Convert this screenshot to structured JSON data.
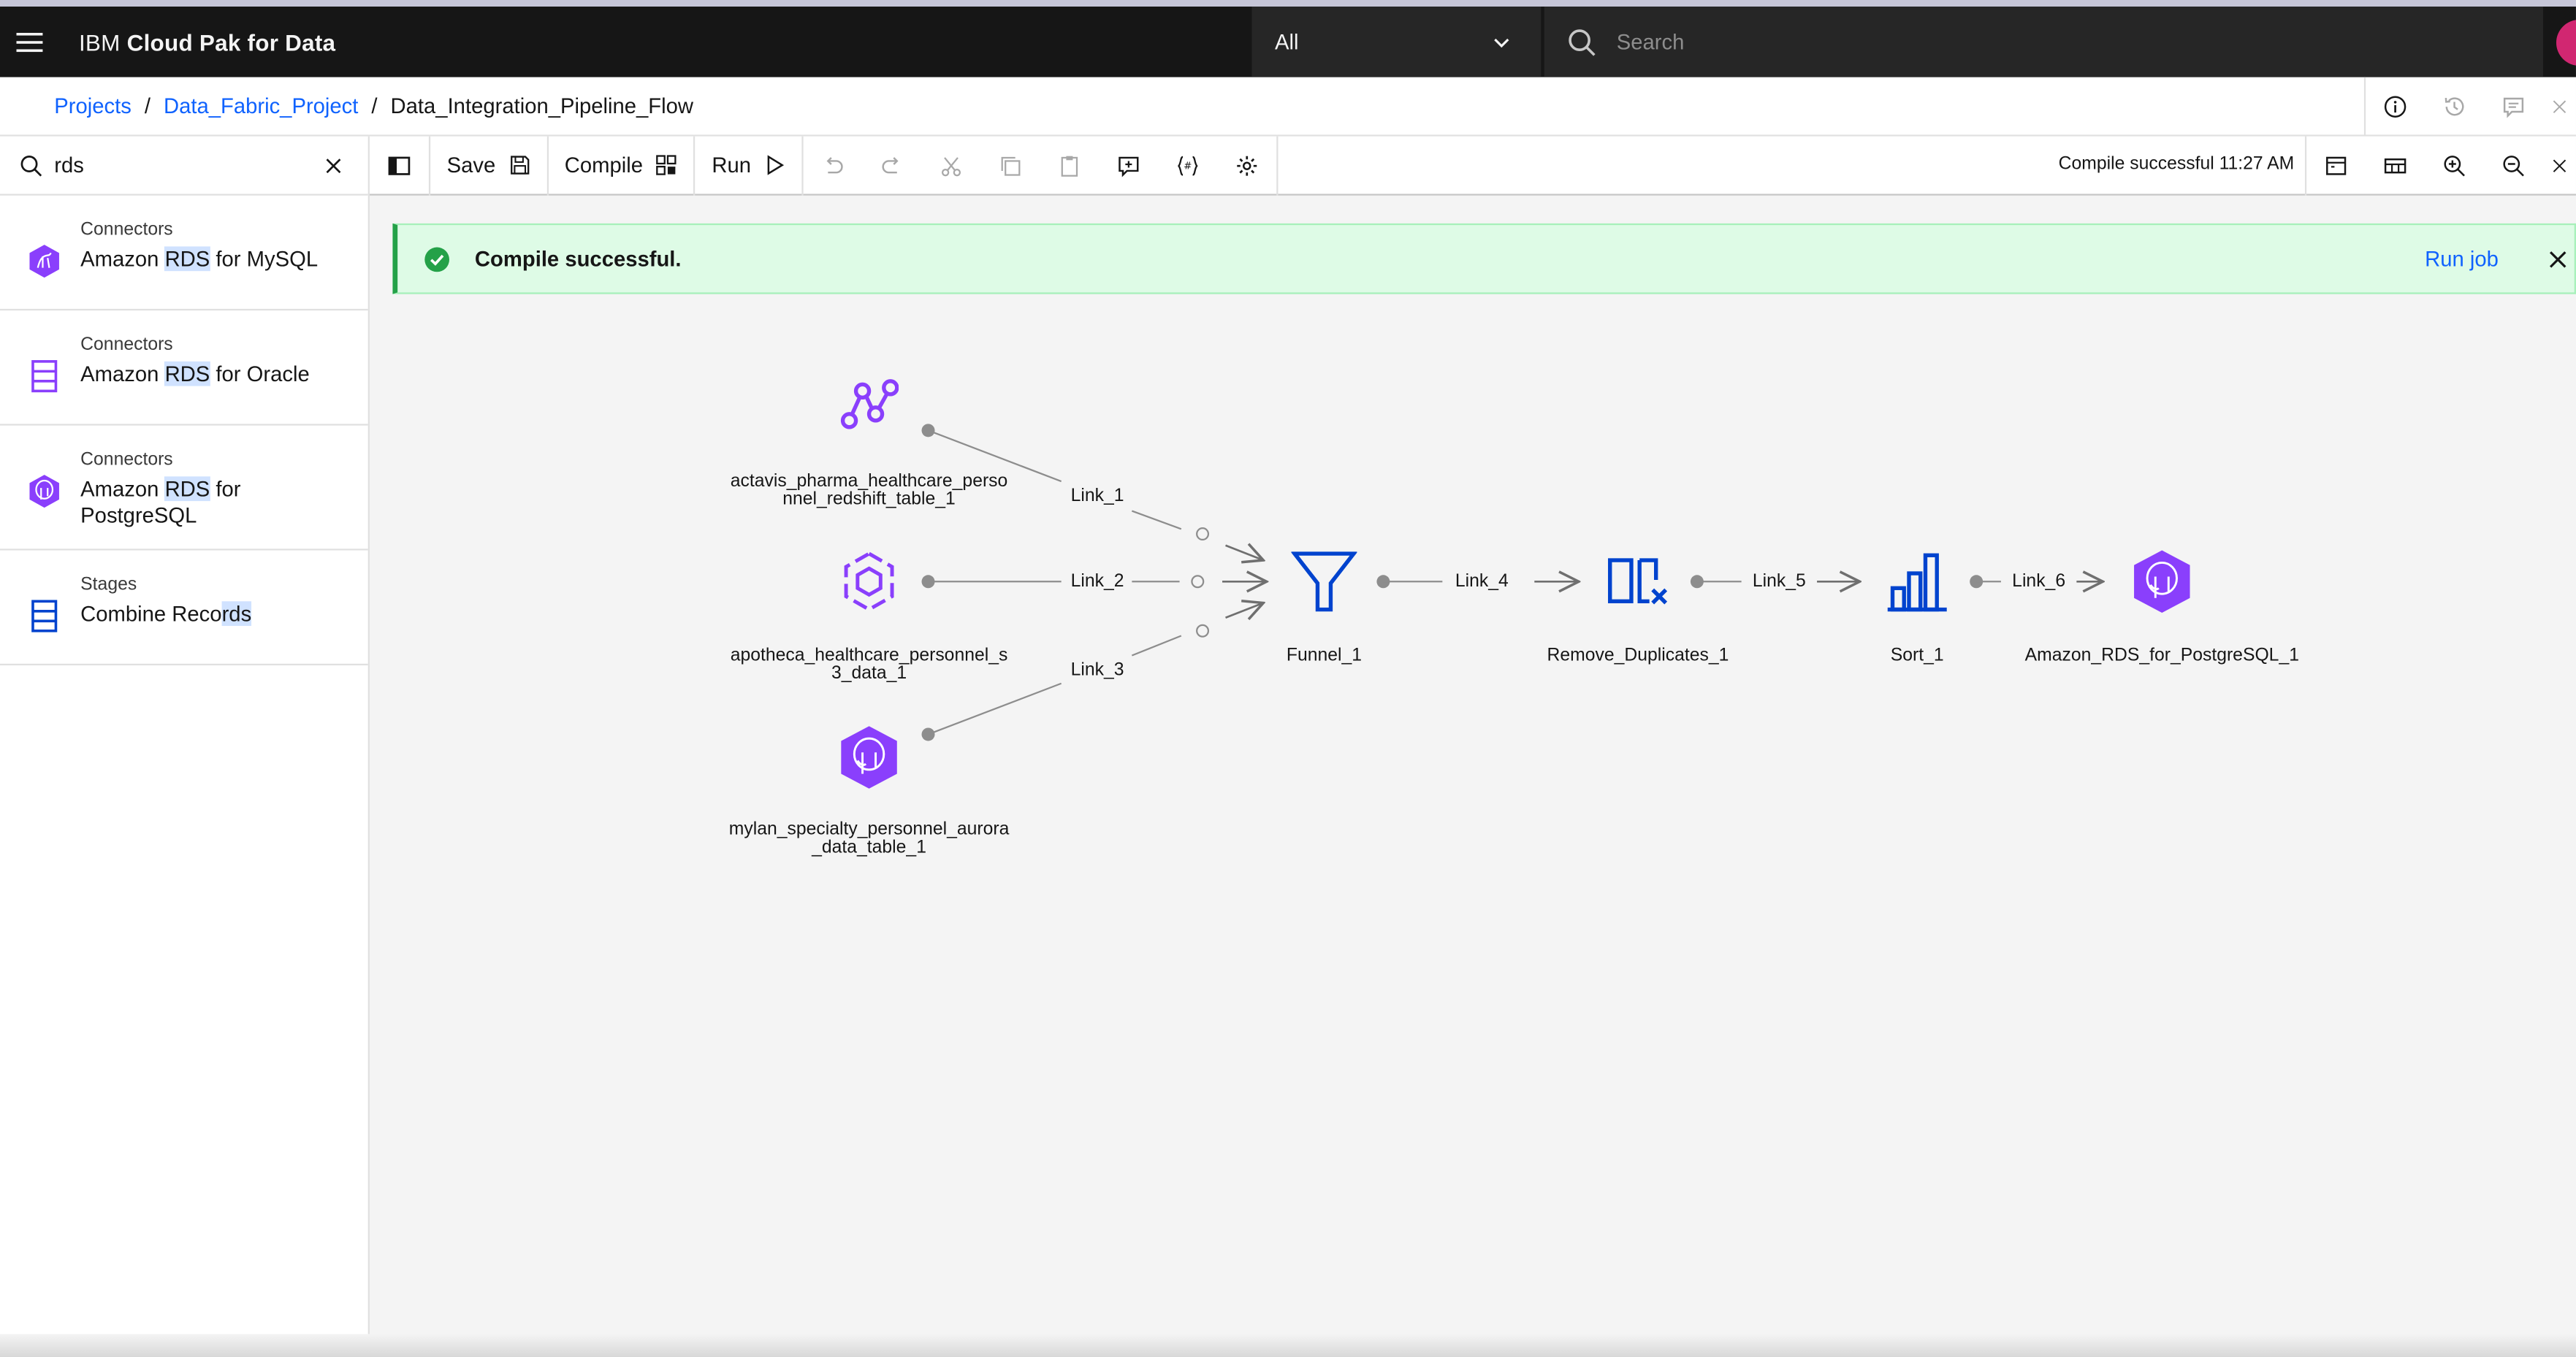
{
  "header": {
    "brand_prefix": "IBM",
    "brand_name": "Cloud Pak for Data",
    "scope_value": "All",
    "search_placeholder": "Search"
  },
  "breadcrumb": {
    "items": [
      "Projects",
      "Data_Fabric_Project"
    ],
    "separator": "/",
    "current": "Data_Integration_Pipeline_Flow"
  },
  "palette": {
    "search_value": "rds",
    "items": [
      {
        "category": "Connectors",
        "pre": "Amazon ",
        "hl": "RDS",
        "post": " for MySQL"
      },
      {
        "category": "Connectors",
        "pre": "Amazon ",
        "hl": "RDS",
        "post": " for Oracle"
      },
      {
        "category": "Connectors",
        "pre": "Amazon ",
        "hl": "RDS",
        "post": " for PostgreSQL"
      },
      {
        "category": "Stages",
        "pre": "Combine Reco",
        "hl": "rds",
        "post": ""
      }
    ]
  },
  "toolbar": {
    "save_label": "Save",
    "compile_label": "Compile",
    "run_label": "Run",
    "status": "Compile successful 11:27 AM"
  },
  "notification": {
    "message": "Compile successful.",
    "action": "Run job"
  },
  "flow": {
    "nodes": {
      "src1": "actavis_pharma_healthcare_perso nnel_redshift_table_1",
      "src2": "apotheca_healthcare_personnel_s 3_data_1",
      "src3": "mylan_specialty_personnel_aurora _data_table_1",
      "funnel": "Funnel_1",
      "dedup": "Remove_Duplicates_1",
      "sort": "Sort_1",
      "target": "Amazon_RDS_for_PostgreSQL_1"
    },
    "links": {
      "l1": "Link_1",
      "l2": "Link_2",
      "l3": "Link_3",
      "l4": "Link_4",
      "l5": "Link_5",
      "l6": "Link_6"
    }
  },
  "colors": {
    "brand_purple": "#8a3ffc",
    "accent_blue": "#0f62fe",
    "success_green": "#24a148",
    "stage_blue": "#0043ce"
  }
}
